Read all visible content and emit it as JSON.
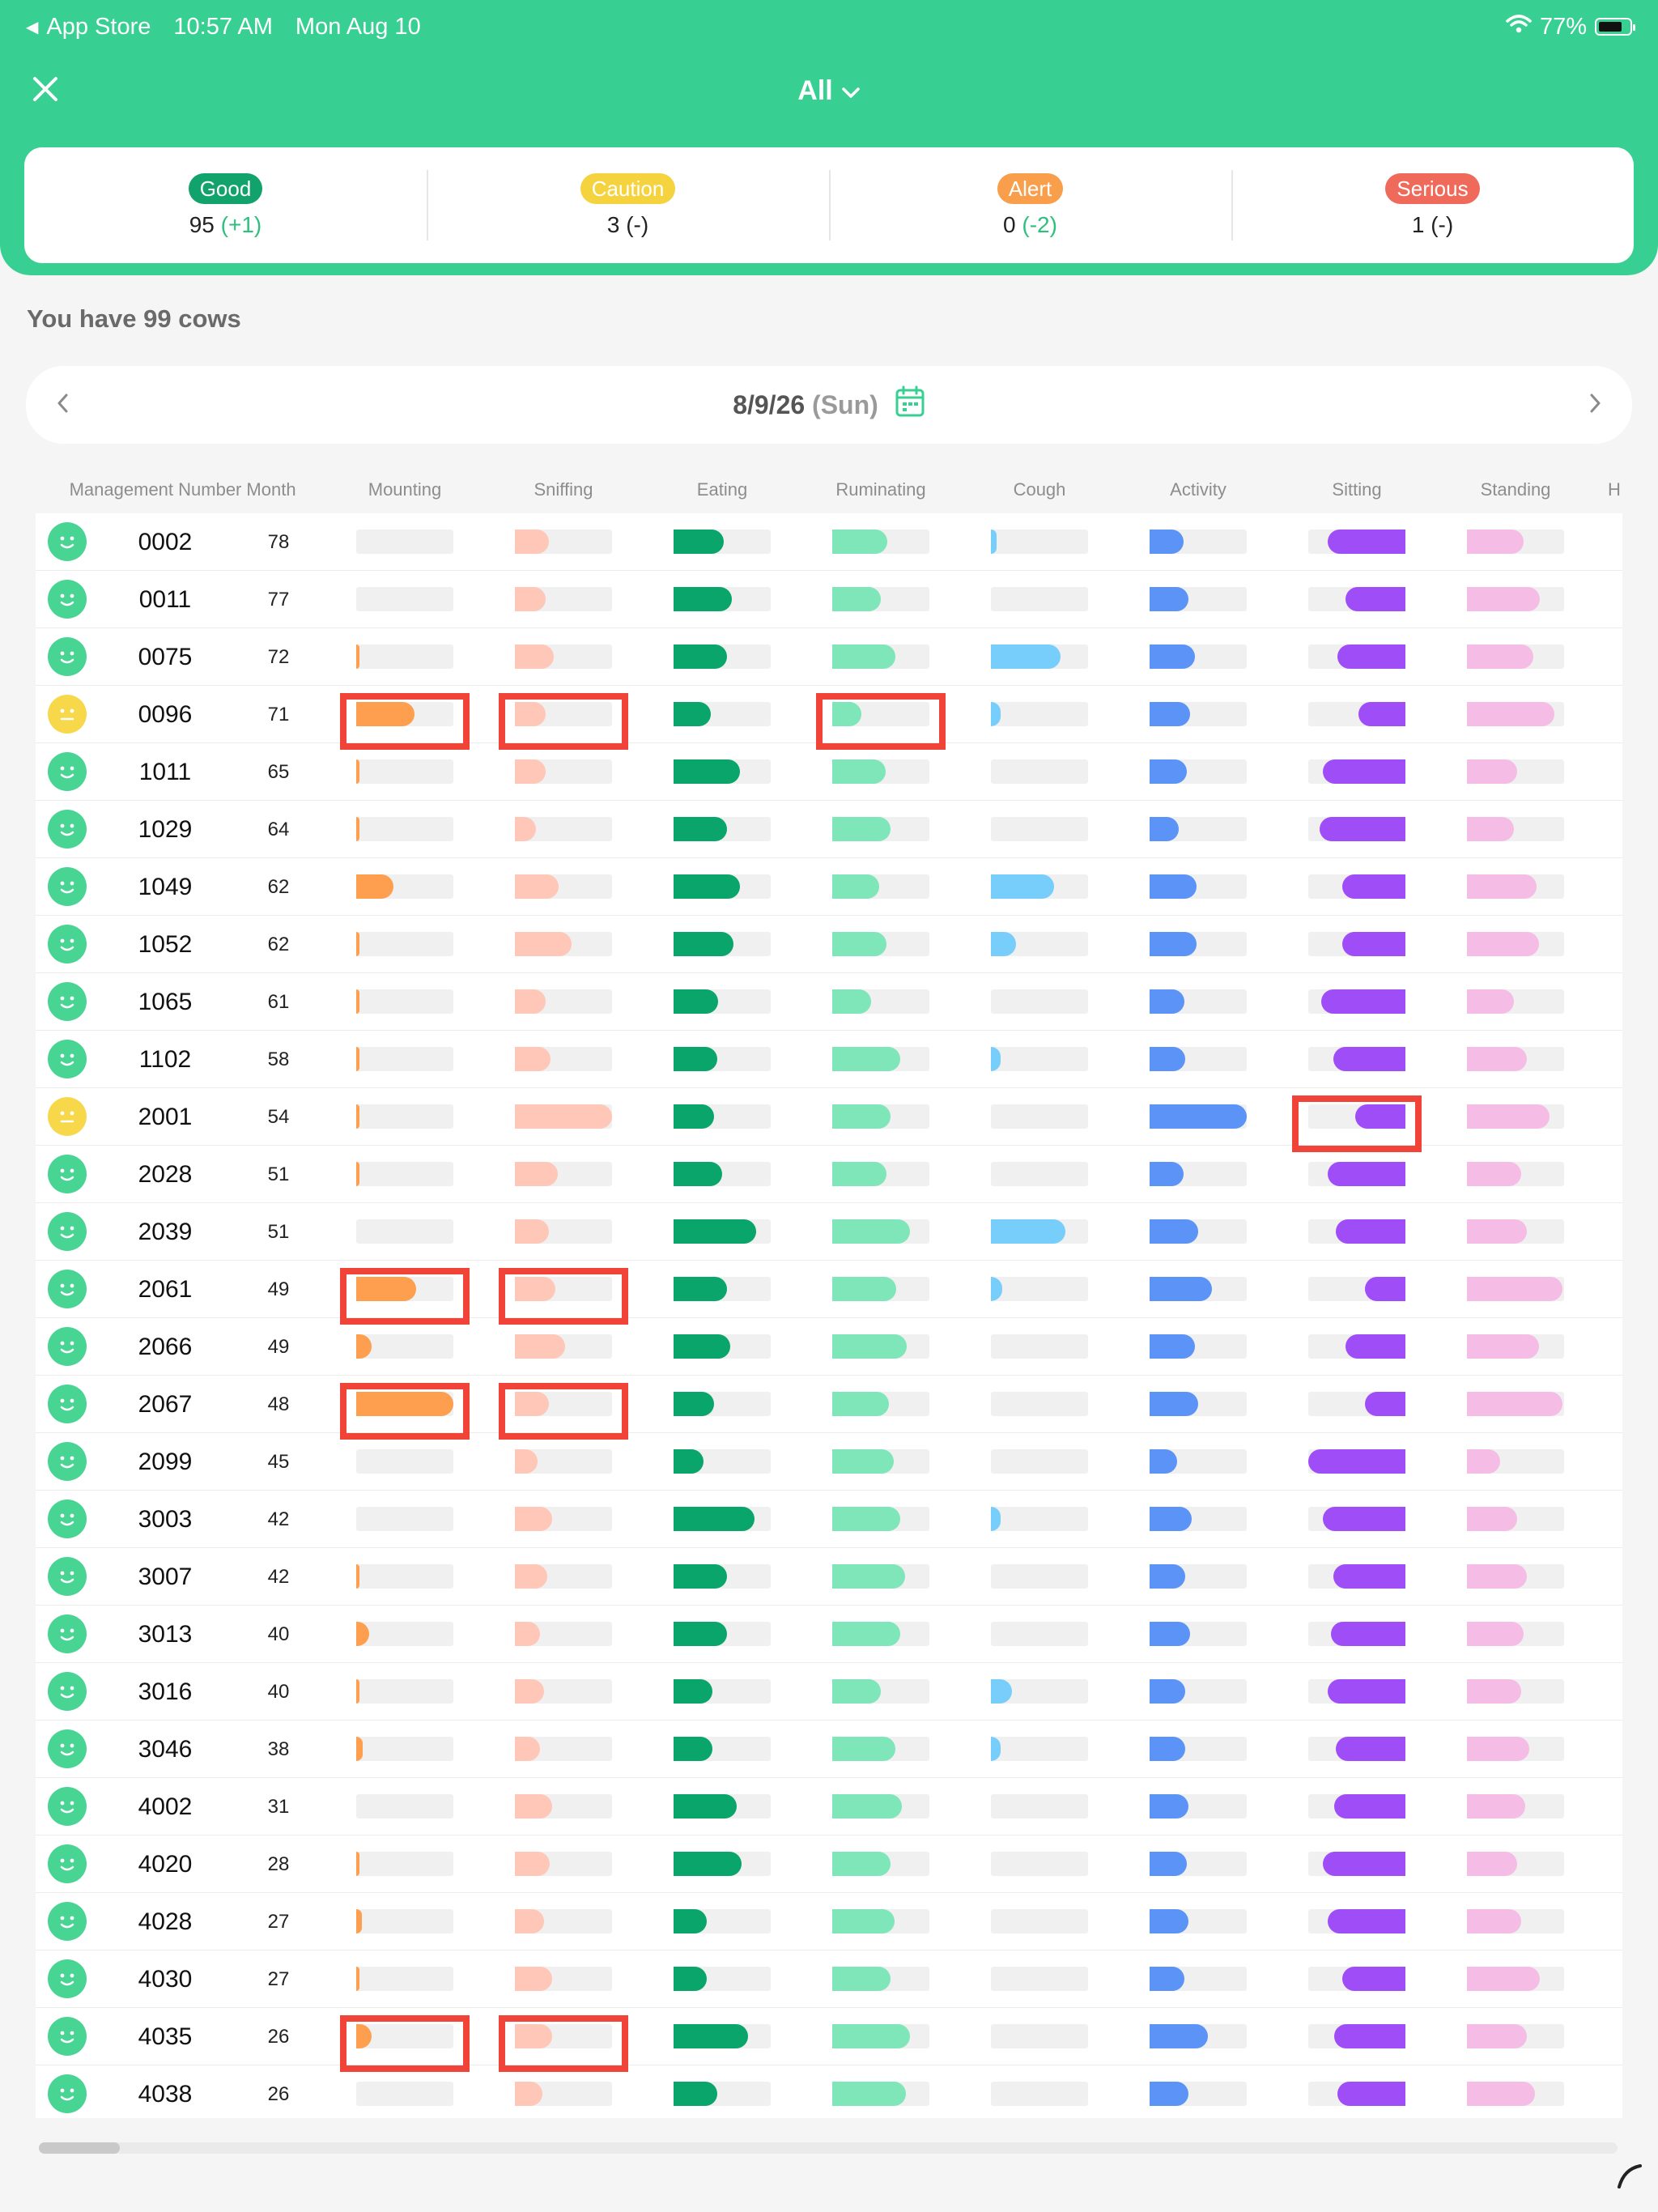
{
  "status_bar": {
    "back_app": "App Store",
    "time": "10:57 AM",
    "date": "Mon Aug 10",
    "battery": "77%",
    "battery_level": 0.77
  },
  "header": {
    "filter_label": "All"
  },
  "summary": [
    {
      "label": "Good",
      "value": "95",
      "delta": "(+1)",
      "color": "#11a36b"
    },
    {
      "label": "Caution",
      "value": "3",
      "delta": "(-)",
      "color": "#f5d33f"
    },
    {
      "label": "Alert",
      "value": "0",
      "delta": "(-2)",
      "color": "#f99e4b"
    },
    {
      "label": "Serious",
      "value": "1",
      "delta": "(-)",
      "color": "#ef6a5a"
    }
  ],
  "cow_count_text": "You have 99 cows",
  "date_nav": {
    "date": "8/9/26",
    "day": "(Sun)"
  },
  "table": {
    "headers": [
      "Management Number",
      "Month",
      "Mounting",
      "Sniffing",
      "Eating",
      "Ruminating",
      "Cough",
      "Activity",
      "Sitting",
      "Standing",
      "H"
    ],
    "colors": {
      "mounting": "#fd9f4f",
      "sniffing": "#fec7b7",
      "eating": "#09a56b",
      "ruminating": "#7ee6b9",
      "cough": "#77cefb",
      "activity": "#5b93f6",
      "sitting": "#9e4df7",
      "standing": "#f5bde5",
      "face_good": "#48d492",
      "face_caution": "#f8d84b",
      "highlight": "#f04438"
    },
    "rows": [
      {
        "id": "0002",
        "month": "78",
        "status": "good",
        "mounting": 0,
        "sniffing": 0.35,
        "eating": 0.52,
        "ruminating": 0.57,
        "cough": 0.06,
        "activity": 0.35,
        "sitting": 0.8,
        "standing": 0.58,
        "hl": []
      },
      {
        "id": "0011",
        "month": "77",
        "status": "good",
        "mounting": 0,
        "sniffing": 0.32,
        "eating": 0.6,
        "ruminating": 0.5,
        "cough": 0,
        "activity": 0.4,
        "sitting": 0.62,
        "standing": 0.75,
        "hl": []
      },
      {
        "id": "0075",
        "month": "72",
        "status": "good",
        "mounting": 0.02,
        "sniffing": 0.4,
        "eating": 0.55,
        "ruminating": 0.65,
        "cough": 0.72,
        "activity": 0.47,
        "sitting": 0.7,
        "standing": 0.68,
        "hl": []
      },
      {
        "id": "0096",
        "month": "71",
        "status": "caution",
        "mounting": 0.6,
        "sniffing": 0.32,
        "eating": 0.38,
        "ruminating": 0.3,
        "cough": 0.1,
        "activity": 0.42,
        "sitting": 0.48,
        "standing": 0.9,
        "hl": [
          "mounting",
          "sniffing",
          "ruminating"
        ]
      },
      {
        "id": "1011",
        "month": "65",
        "status": "good",
        "mounting": 0.02,
        "sniffing": 0.32,
        "eating": 0.68,
        "ruminating": 0.55,
        "cough": 0,
        "activity": 0.38,
        "sitting": 0.85,
        "standing": 0.52,
        "hl": []
      },
      {
        "id": "1029",
        "month": "64",
        "status": "good",
        "mounting": 0.03,
        "sniffing": 0.22,
        "eating": 0.55,
        "ruminating": 0.6,
        "cough": 0,
        "activity": 0.3,
        "sitting": 0.88,
        "standing": 0.48,
        "hl": []
      },
      {
        "id": "1049",
        "month": "62",
        "status": "good",
        "mounting": 0.38,
        "sniffing": 0.45,
        "eating": 0.68,
        "ruminating": 0.48,
        "cough": 0.65,
        "activity": 0.48,
        "sitting": 0.65,
        "standing": 0.72,
        "hl": []
      },
      {
        "id": "1052",
        "month": "62",
        "status": "good",
        "mounting": 0.03,
        "sniffing": 0.58,
        "eating": 0.62,
        "ruminating": 0.56,
        "cough": 0.26,
        "activity": 0.48,
        "sitting": 0.65,
        "standing": 0.74,
        "hl": []
      },
      {
        "id": "1065",
        "month": "61",
        "status": "good",
        "mounting": 0.02,
        "sniffing": 0.32,
        "eating": 0.46,
        "ruminating": 0.4,
        "cough": 0,
        "activity": 0.36,
        "sitting": 0.87,
        "standing": 0.48,
        "hl": []
      },
      {
        "id": "1102",
        "month": "58",
        "status": "good",
        "mounting": 0.02,
        "sniffing": 0.37,
        "eating": 0.45,
        "ruminating": 0.7,
        "cough": 0.1,
        "activity": 0.37,
        "sitting": 0.74,
        "standing": 0.62,
        "hl": []
      },
      {
        "id": "2001",
        "month": "54",
        "status": "caution",
        "mounting": 0.02,
        "sniffing": 1.0,
        "eating": 0.42,
        "ruminating": 0.6,
        "cough": 0,
        "activity": 1.0,
        "sitting": 0.52,
        "standing": 0.85,
        "hl": [
          "sitting"
        ]
      },
      {
        "id": "2028",
        "month": "51",
        "status": "good",
        "mounting": 0.02,
        "sniffing": 0.44,
        "eating": 0.5,
        "ruminating": 0.56,
        "cough": 0,
        "activity": 0.35,
        "sitting": 0.8,
        "standing": 0.56,
        "hl": []
      },
      {
        "id": "2039",
        "month": "51",
        "status": "good",
        "mounting": 0,
        "sniffing": 0.35,
        "eating": 0.85,
        "ruminating": 0.8,
        "cough": 0.77,
        "activity": 0.5,
        "sitting": 0.72,
        "standing": 0.62,
        "hl": []
      },
      {
        "id": "2061",
        "month": "49",
        "status": "good",
        "mounting": 0.62,
        "sniffing": 0.42,
        "eating": 0.55,
        "ruminating": 0.66,
        "cough": 0.12,
        "activity": 0.64,
        "sitting": 0.42,
        "standing": 0.98,
        "hl": [
          "mounting",
          "sniffing"
        ]
      },
      {
        "id": "2066",
        "month": "49",
        "status": "good",
        "mounting": 0.16,
        "sniffing": 0.52,
        "eating": 0.58,
        "ruminating": 0.77,
        "cough": 0,
        "activity": 0.47,
        "sitting": 0.62,
        "standing": 0.74,
        "hl": []
      },
      {
        "id": "2067",
        "month": "48",
        "status": "good",
        "mounting": 1.0,
        "sniffing": 0.35,
        "eating": 0.42,
        "ruminating": 0.58,
        "cough": 0,
        "activity": 0.5,
        "sitting": 0.42,
        "standing": 0.98,
        "hl": [
          "mounting",
          "sniffing"
        ]
      },
      {
        "id": "2099",
        "month": "45",
        "status": "good",
        "mounting": 0,
        "sniffing": 0.23,
        "eating": 0.31,
        "ruminating": 0.63,
        "cough": 0,
        "activity": 0.28,
        "sitting": 1.0,
        "standing": 0.34,
        "hl": []
      },
      {
        "id": "3003",
        "month": "42",
        "status": "good",
        "mounting": 0,
        "sniffing": 0.38,
        "eating": 0.83,
        "ruminating": 0.7,
        "cough": 0.1,
        "activity": 0.43,
        "sitting": 0.85,
        "standing": 0.52,
        "hl": []
      },
      {
        "id": "3007",
        "month": "42",
        "status": "good",
        "mounting": 0.02,
        "sniffing": 0.33,
        "eating": 0.55,
        "ruminating": 0.75,
        "cough": 0,
        "activity": 0.37,
        "sitting": 0.74,
        "standing": 0.62,
        "hl": []
      },
      {
        "id": "3013",
        "month": "40",
        "status": "good",
        "mounting": 0.13,
        "sniffing": 0.26,
        "eating": 0.55,
        "ruminating": 0.7,
        "cough": 0,
        "activity": 0.42,
        "sitting": 0.77,
        "standing": 0.58,
        "hl": []
      },
      {
        "id": "3016",
        "month": "40",
        "status": "good",
        "mounting": 0.02,
        "sniffing": 0.3,
        "eating": 0.4,
        "ruminating": 0.5,
        "cough": 0.22,
        "activity": 0.37,
        "sitting": 0.8,
        "standing": 0.56,
        "hl": []
      },
      {
        "id": "3046",
        "month": "38",
        "status": "good",
        "mounting": 0.07,
        "sniffing": 0.26,
        "eating": 0.4,
        "ruminating": 0.65,
        "cough": 0.1,
        "activity": 0.37,
        "sitting": 0.72,
        "standing": 0.64,
        "hl": []
      },
      {
        "id": "4002",
        "month": "31",
        "status": "good",
        "mounting": 0,
        "sniffing": 0.38,
        "eating": 0.65,
        "ruminating": 0.72,
        "cough": 0,
        "activity": 0.4,
        "sitting": 0.73,
        "standing": 0.6,
        "hl": []
      },
      {
        "id": "4020",
        "month": "28",
        "status": "good",
        "mounting": 0.02,
        "sniffing": 0.36,
        "eating": 0.7,
        "ruminating": 0.6,
        "cough": 0,
        "activity": 0.38,
        "sitting": 0.85,
        "standing": 0.52,
        "hl": []
      },
      {
        "id": "4028",
        "month": "27",
        "status": "good",
        "mounting": 0.06,
        "sniffing": 0.3,
        "eating": 0.34,
        "ruminating": 0.64,
        "cough": 0,
        "activity": 0.4,
        "sitting": 0.8,
        "standing": 0.56,
        "hl": []
      },
      {
        "id": "4030",
        "month": "27",
        "status": "good",
        "mounting": 0.02,
        "sniffing": 0.38,
        "eating": 0.34,
        "ruminating": 0.6,
        "cough": 0,
        "activity": 0.36,
        "sitting": 0.65,
        "standing": 0.75,
        "hl": []
      },
      {
        "id": "4035",
        "month": "26",
        "status": "good",
        "mounting": 0.16,
        "sniffing": 0.38,
        "eating": 0.77,
        "ruminating": 0.8,
        "cough": 0,
        "activity": 0.6,
        "sitting": 0.73,
        "standing": 0.62,
        "hl": [
          "mounting",
          "sniffing"
        ]
      },
      {
        "id": "4038",
        "month": "26",
        "status": "good",
        "mounting": 0,
        "sniffing": 0.28,
        "eating": 0.45,
        "ruminating": 0.76,
        "cough": 0,
        "activity": 0.4,
        "sitting": 0.7,
        "standing": 0.7,
        "hl": []
      }
    ]
  }
}
